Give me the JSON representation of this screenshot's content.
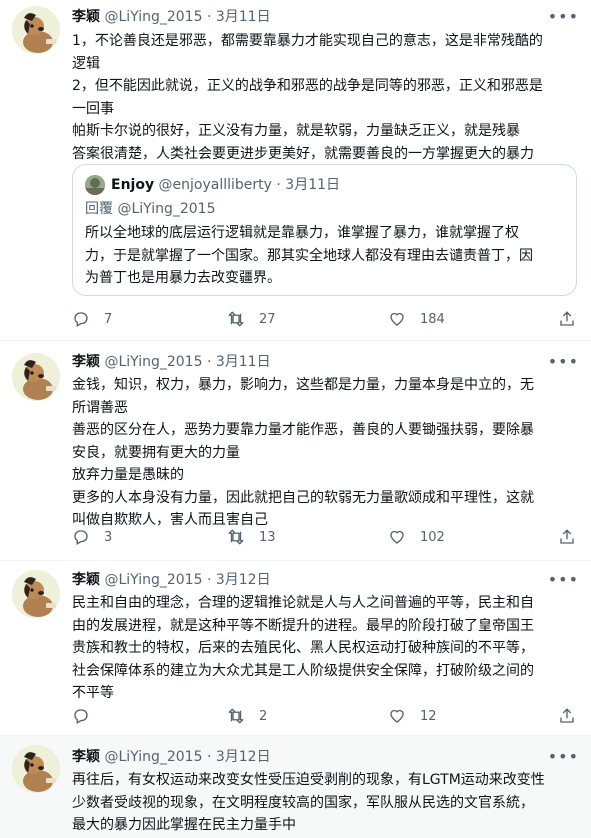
{
  "author": {
    "name": "李颖",
    "handle": "@LiYing_2015"
  },
  "tweets": [
    {
      "date": "3月11日",
      "body": [
        "1，不论善良还是邪恶，都需要靠暴力才能实现自己的意志，这是非常残酷的",
        "逻辑",
        "2，但不能因此就说，正义的战争和邪恶的战争是同等的邪恶，正义和邪恶是",
        "一回事",
        "帕斯卡尔说的很好，正义没有力量，就是软弱，力量缺乏正义，就是残暴",
        "答案很清楚，人类社会要更进步更美好，就需要善良的一方掌握更大的暴力"
      ],
      "quote": {
        "name": "Enjoy",
        "handle": "@enjoyallliberty",
        "date": "3月11日",
        "reply_prefix": "回覆",
        "reply_to": "@LiYing_2015",
        "body": [
          "所以全地球的底层运行逻辑就是靠暴力，谁掌握了暴力，谁就掌握了权",
          "力，于是就掌握了一个国家。那其实全地球人都没有理由去谴责普丁，因",
          "为普丁也是用暴力去改变疆界。"
        ]
      },
      "replies": "7",
      "retweets": "27",
      "likes": "184"
    },
    {
      "date": "3月11日",
      "body": [
        "金钱，知识，权力，暴力，影响力，这些都是力量，力量本身是中立的，无",
        "所谓善恶",
        "善恶的区分在人，恶势力要靠力量才能作恶，善良的人要锄强扶弱，要除暴",
        "安良，就要拥有更大的力量",
        "放弃力量是愚昧的",
        "更多的人本身没有力量，因此就把自己的软弱无力量歌颂成和平理性，这就",
        "叫做自欺欺人，害人而且害自己"
      ],
      "replies": "3",
      "retweets": "13",
      "likes": "102"
    },
    {
      "date": "3月12日",
      "body": [
        "民主和自由的理念，合理的逻辑推论就是人与人之间普遍的平等，民主和自",
        "由的发展进程，就是这种平等不断提升的进程。最早的阶段打破了皇帝国王",
        "贵族和教士的特权，后来的去殖民化、黑人民权运动打破种族间的不平等，",
        "社会保障体系的建立为大众尤其是工人阶级提供安全保障，打破阶级之间的",
        "不平等"
      ],
      "replies": "",
      "retweets": "2",
      "likes": "12"
    },
    {
      "date": "3月12日",
      "body": [
        "再往后，有女权运动来改变女性受压迫受剥削的现象，有LGTM运动来改变性",
        "少数者受歧视的现象，在文明程度较高的国家，军队服从民选的文官系統，",
        "最大的暴力因此掌握在民主力量手中"
      ]
    }
  ],
  "separator": "·",
  "icons": [
    "more-icon",
    "reply-icon",
    "retweet-icon",
    "like-icon",
    "share-icon"
  ],
  "colors": {
    "text": "#0f1419",
    "secondary": "#536471",
    "border": "#cfd9de",
    "divider": "#eff3f4",
    "highlight": "#f7f9f9"
  }
}
